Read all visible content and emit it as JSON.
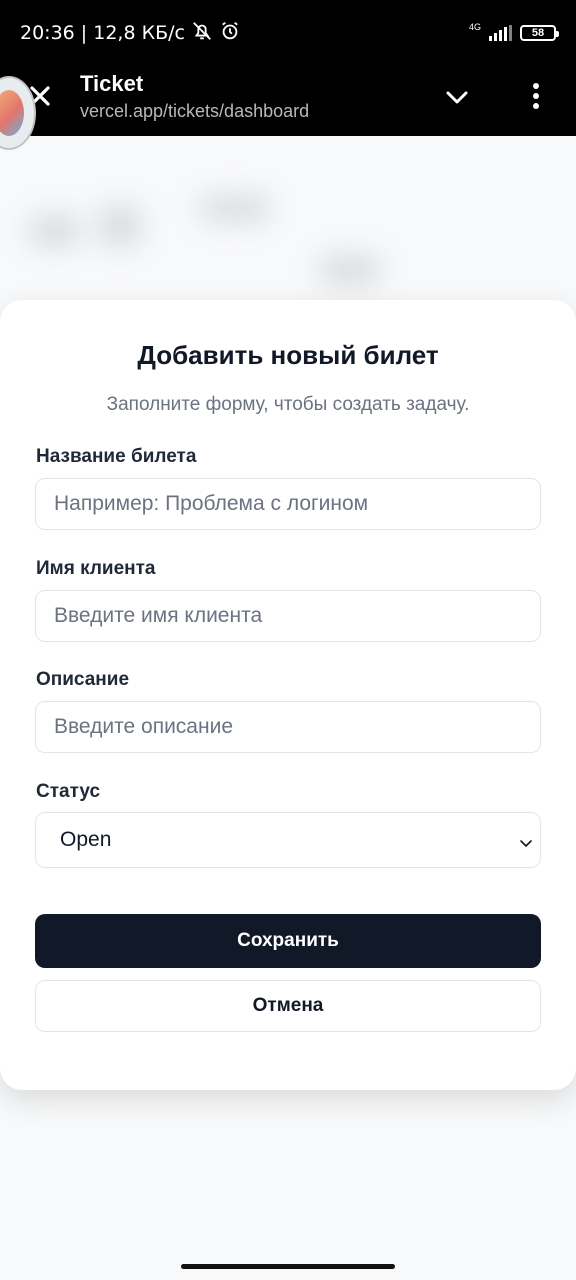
{
  "status_bar": {
    "time_and_speed": "20:36 | 12,8 КБ/с",
    "network_type": "4G",
    "battery_level": "58",
    "icons": [
      "bell-off-icon",
      "alarm-icon",
      "signal-icon",
      "battery-icon"
    ]
  },
  "browser": {
    "title": "Ticket",
    "url": "vercel.app/tickets/dashboard"
  },
  "modal": {
    "title": "Добавить новый билет",
    "subtitle": "Заполните форму, чтобы создать задачу.",
    "fields": {
      "ticket_name": {
        "label": "Название билета",
        "placeholder": "Например: Проблема с логином",
        "value": ""
      },
      "client_name": {
        "label": "Имя клиента",
        "placeholder": "Введите имя клиента",
        "value": ""
      },
      "description": {
        "label": "Описание",
        "placeholder": "Введите описание",
        "value": ""
      },
      "status": {
        "label": "Статус",
        "selected": "Open"
      }
    },
    "save_label": "Сохранить",
    "cancel_label": "Отмена"
  },
  "colors": {
    "primary_button": "#111827",
    "header_bg": "#000000",
    "placeholder": "#6b7280"
  }
}
